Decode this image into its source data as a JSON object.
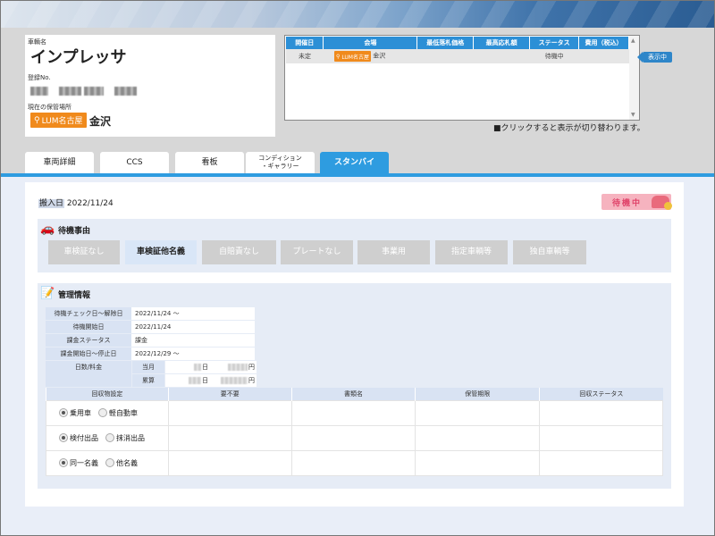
{
  "vehicle": {
    "name_label": "車輌名",
    "name": "インプレッサ",
    "reg_label": "登録No.",
    "storage_label": "現在の保管場所",
    "storage_badge": "LUM名古屋",
    "storage_city": "金沢"
  },
  "auction": {
    "headers": [
      "開催日",
      "会場",
      "最低落札価格",
      "最高応札額",
      "ステータス",
      "費用（税込）"
    ],
    "row": {
      "date": "未定",
      "venue_badge": "LUM名古屋",
      "venue_city": "金沢",
      "min": "",
      "max": "",
      "status": "待機中",
      "fee": ""
    },
    "display_tag": "表示中",
    "note": "■クリックすると表示が切り替わります。"
  },
  "tabs": [
    {
      "label": "車両詳細"
    },
    {
      "label": "CCS"
    },
    {
      "label": "看板"
    },
    {
      "label": "コンディション\n・ギャラリー"
    },
    {
      "label": "スタンバイ",
      "active": true
    }
  ],
  "arrival": {
    "label": "搬入日",
    "date": "2022/11/24"
  },
  "status_badge": "待機中",
  "standby": {
    "title": "待機事由",
    "reasons": [
      {
        "label": "車検証なし",
        "selected": false
      },
      {
        "label": "車検証他名義",
        "selected": true
      },
      {
        "label": "自賠責なし",
        "selected": false
      },
      {
        "label": "プレートなし",
        "selected": false
      },
      {
        "label": "事業用",
        "selected": false
      },
      {
        "label": "指定車輌等",
        "selected": false
      },
      {
        "label": "独自車輌等",
        "selected": false
      }
    ]
  },
  "management": {
    "title": "管理情報",
    "rows": [
      {
        "label": "待機チェック日～解除日",
        "value": "2022/11/24 ～"
      },
      {
        "label": "待機開始日",
        "value": "2022/11/24"
      },
      {
        "label": "課金ステータス",
        "value": "課金"
      },
      {
        "label": "課金開始日～停止日",
        "value": "2022/12/29 ～"
      }
    ],
    "days_fee": {
      "label": "日数/料金",
      "current": "当月",
      "total": "累算",
      "day_unit": "日",
      "yen_unit": "円"
    },
    "collect_headers": [
      "回収物設定",
      "要不要",
      "書類名",
      "保管期限",
      "回収ステータス"
    ],
    "radio_rows": [
      [
        {
          "label": "乗用車",
          "on": true
        },
        {
          "label": "軽自動車",
          "on": false
        }
      ],
      [
        {
          "label": "検付出品",
          "on": true
        },
        {
          "label": "抹消出品",
          "on": false
        }
      ],
      [
        {
          "label": "同一名義",
          "on": true
        },
        {
          "label": "他名義",
          "on": false
        }
      ]
    ]
  }
}
